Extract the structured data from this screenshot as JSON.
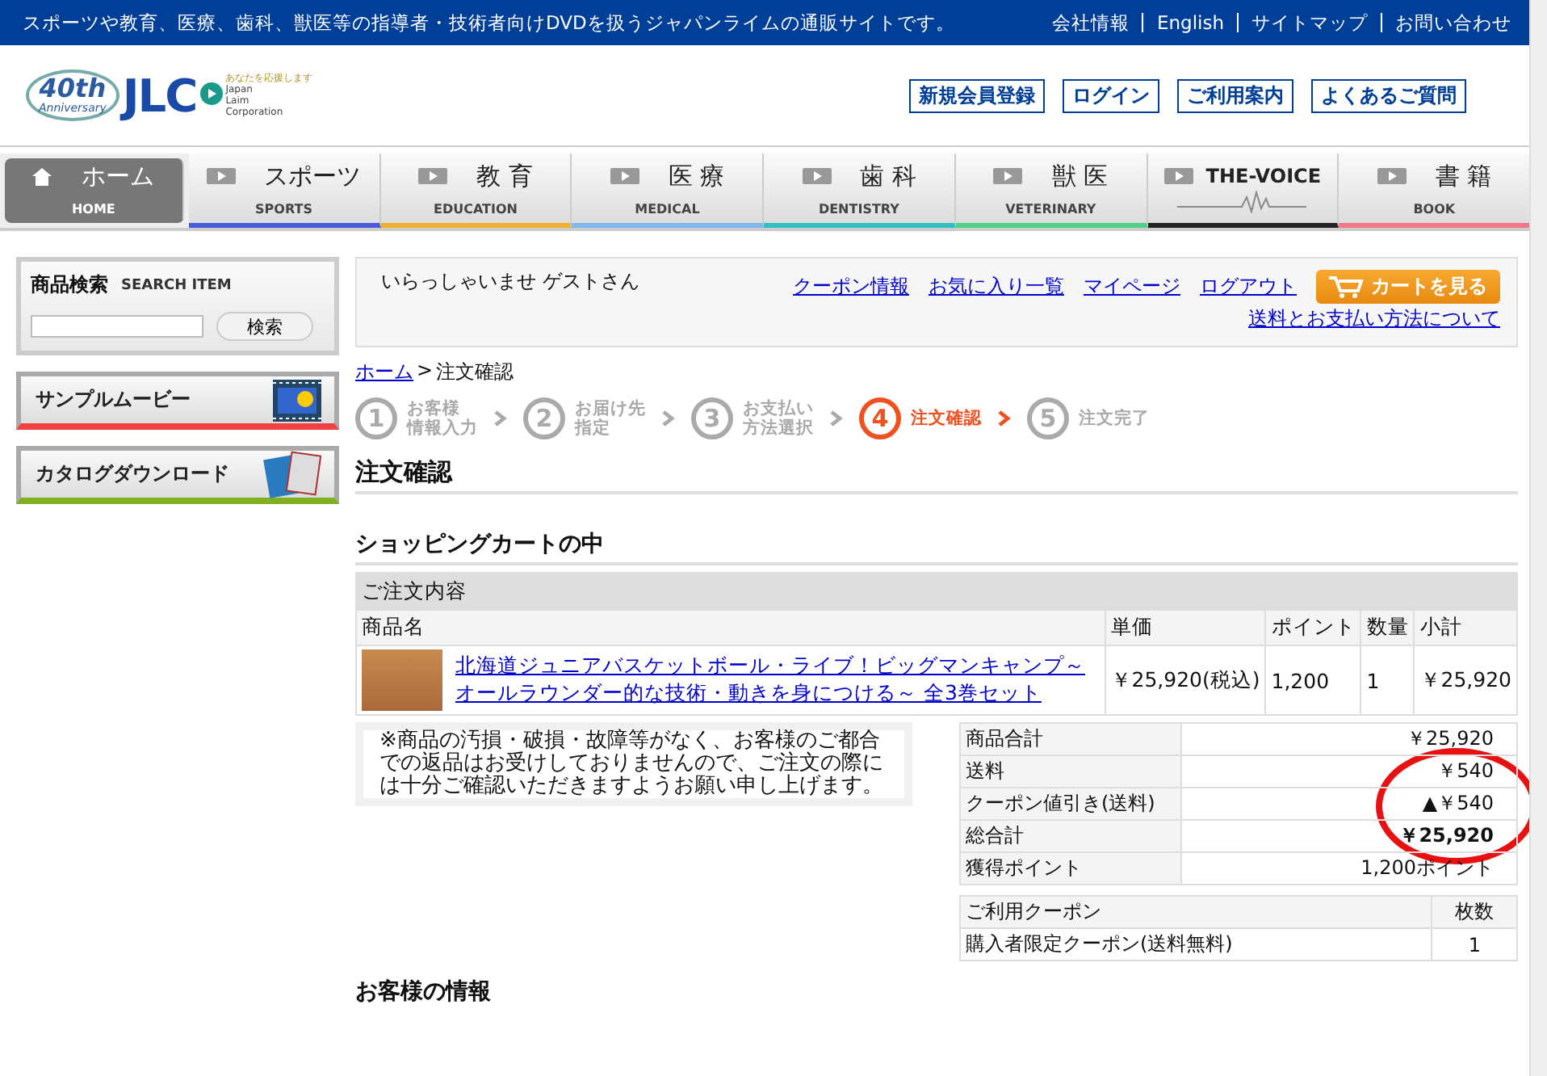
{
  "top_bar": {
    "tagline": "スポーツや教育、医療、歯科、獣医等の指導者・技術者向けDVDを扱うジャパンライムの通販サイトです。",
    "links": [
      "会社情報",
      "English",
      "サイトマップ",
      "お問い合わせ"
    ]
  },
  "logo": {
    "badge_number": "40th",
    "badge_text": "Anniversary",
    "wordmark": "JLC",
    "slogan": "あなたを応援します",
    "company_lines": [
      "Japan",
      "Laim",
      "Corporation"
    ]
  },
  "header_buttons": [
    "新規会員登録",
    "ログイン",
    "ご利用案内",
    "よくあるご質問"
  ],
  "nav": [
    {
      "label": "ホーム",
      "sub": "HOME",
      "selected": true
    },
    {
      "label": "スポーツ",
      "sub": "SPORTS",
      "selected": false,
      "color": "#4a5ad8"
    },
    {
      "label": "教 育",
      "sub": "EDUCATION",
      "selected": false,
      "color": "#f0b030"
    },
    {
      "label": "医 療",
      "sub": "MEDICAL",
      "selected": false,
      "color": "#80b8f0"
    },
    {
      "label": "歯 科",
      "sub": "DENTISTRY",
      "selected": false,
      "color": "#30c0c0"
    },
    {
      "label": "獣 医",
      "sub": "VETERINARY",
      "selected": false,
      "color": "#50d088"
    },
    {
      "label": "THE-VOICE",
      "selected": false,
      "color": "#222222"
    },
    {
      "label": "書 籍",
      "sub": "BOOK",
      "selected": false,
      "color": "#f07888"
    }
  ],
  "sidebar": {
    "search": {
      "title": "商品検索",
      "title_en": "SEARCH ITEM",
      "button": "検索"
    },
    "banners": [
      {
        "label": "サンプルムービー",
        "color": "#f04040"
      },
      {
        "label": "カタログダウンロード",
        "color": "#80b020"
      }
    ]
  },
  "welcome": {
    "greeting": "いらっしゃいませ ゲストさん",
    "links": [
      "クーポン情報",
      "お気に入り一覧",
      "マイページ",
      "ログアウト"
    ],
    "cart_button": "カートを見る",
    "shipping_link": "送料とお支払い方法について"
  },
  "breadcrumb": {
    "home": "ホーム",
    "separator": ">",
    "current": "注文確認"
  },
  "steps": [
    {
      "number": "1",
      "lines": [
        "お客様",
        "情報入力"
      ],
      "selected": false
    },
    {
      "number": "2",
      "lines": [
        "お届け先",
        "指定"
      ],
      "selected": false
    },
    {
      "number": "3",
      "lines": [
        "お支払い",
        "方法選択"
      ],
      "selected": false
    },
    {
      "number": "4",
      "lines": [
        "注文確認"
      ],
      "selected": true
    },
    {
      "number": "5",
      "lines": [
        "注文完了"
      ],
      "selected": false
    }
  ],
  "page_title": "注文確認",
  "cart": {
    "title": "ショッピングカートの中",
    "table_caption": "ご注文内容",
    "columns": [
      "商品名",
      "単価",
      "ポイント",
      "数量",
      "小計"
    ],
    "rows": [
      {
        "product": "北海道ジュニアバスケットボール・ライブ！ビッグマンキャンプ～オールラウンダー的な技術・動きを身につける～ 全3巻セット",
        "price": "￥25,920(税込)",
        "points": "1,200",
        "quantity": "1",
        "subtotal": "￥25,920"
      }
    ]
  },
  "notice": "※商品の汚損・破損・故障等がなく、お客様のご都合での返品はお受けしておりませんので、ご注文の際には十分ご確認いただきますようお願い申し上げます。",
  "totals": [
    {
      "label": "商品合計",
      "value": "￥25,920",
      "bold": false
    },
    {
      "label": "送料",
      "value": "￥540",
      "bold": false
    },
    {
      "label": "クーポン値引き(送料)",
      "value": "▲￥540",
      "bold": false
    },
    {
      "label": "総合計",
      "value": "￥25,920",
      "bold": true
    },
    {
      "label": "獲得ポイント",
      "value": "1,200ポイント",
      "bold": false
    }
  ],
  "coupons": {
    "columns": [
      "ご利用クーポン",
      "枚数"
    ],
    "rows": [
      [
        "購入者限定クーポン(送料無料)",
        "1"
      ]
    ]
  },
  "next_heading": "お客様の情報",
  "annotation": {
    "kind": "circle",
    "color": "#e81010"
  }
}
